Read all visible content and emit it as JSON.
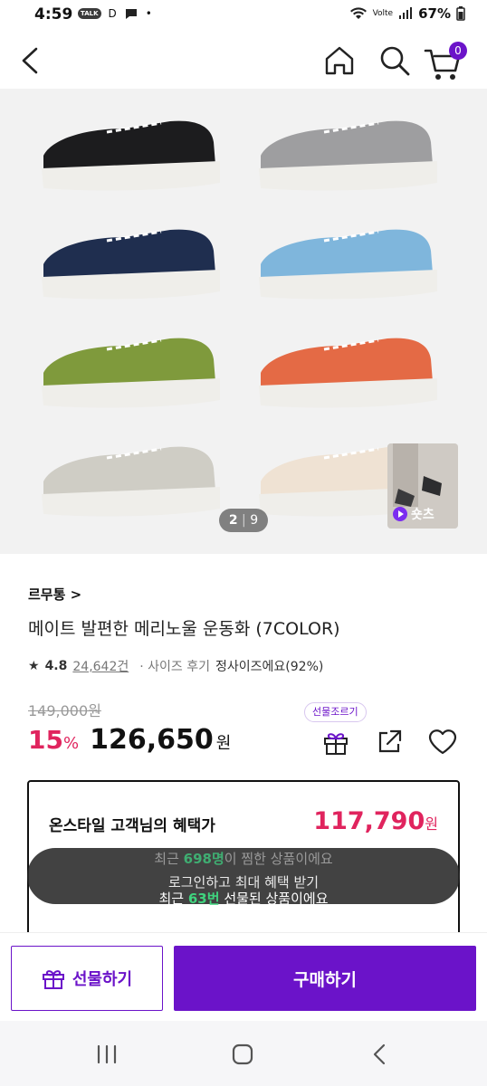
{
  "status_bar": {
    "time": "4:59",
    "talk_badge": "TALK",
    "d_label": "D",
    "dot": "•",
    "network": "Volte",
    "battery": "67%"
  },
  "app_bar": {
    "cart_count": "0"
  },
  "gallery": {
    "page_current": "2",
    "page_total": "9",
    "shorts_label": "숏츠",
    "shoe_colors": [
      "#1c1c1e",
      "#9e9ea0",
      "#1f2e4f",
      "#7fb6dc",
      "#7f9a3c",
      "#e46a45",
      "#cfcdc5",
      "#efe2d3"
    ]
  },
  "product": {
    "brand": "르무통 >",
    "title": "메이트 발편한 메리노울 운동화 (7COLOR)",
    "rating_star": "★",
    "rating": "4.8",
    "review_count": "24,642건",
    "size_review_label": "· 사이즈 후기",
    "size_review_value": "정사이즈에요(92%)",
    "original_price": "149,000원",
    "discount": "15",
    "discount_pct": "%",
    "price": "126,650",
    "price_unit": "원",
    "gift_tag": "선물조르기"
  },
  "benefit": {
    "label": "온스타일 고객님의 혜택가",
    "price": "117,790",
    "price_unit": "원"
  },
  "ticker": {
    "line1_prefix": "최근 ",
    "line1_highlight": "698명",
    "line1_suffix": "이 찜한 상품이에요",
    "line2": "로그인하고 최대 혜택 받기",
    "line3_prefix": "최근 ",
    "line3_highlight": "63번",
    "line3_suffix": " 선물된 상품이에요"
  },
  "bottom_bar": {
    "gift_button": "선물하기",
    "buy_button": "구매하기"
  },
  "colors": {
    "accent": "#6b13c9",
    "sale": "#e0245e"
  }
}
